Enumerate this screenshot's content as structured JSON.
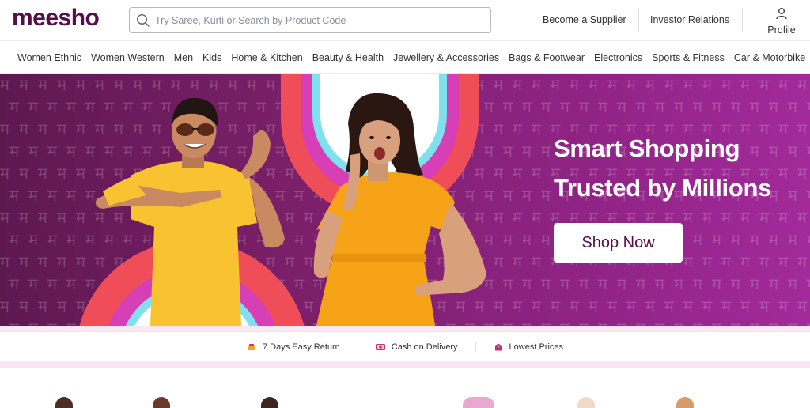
{
  "header": {
    "logo": "meesho",
    "search": {
      "placeholder": "Try Saree, Kurti or Search by Product Code",
      "value": ""
    },
    "links": [
      "Become a Supplier",
      "Investor Relations"
    ],
    "profile_label": "Profile"
  },
  "categories": [
    "Women Ethnic",
    "Women Western",
    "Men",
    "Kids",
    "Home & Kitchen",
    "Beauty & Health",
    "Jewellery & Accessories",
    "Bags & Footwear",
    "Electronics",
    "Sports & Fitness",
    "Car & Motorbike"
  ],
  "hero": {
    "headline_line1": "Smart Shopping",
    "headline_line2": "Trusted by Millions",
    "cta": "Shop Now",
    "pattern_glyph": "म"
  },
  "value_props": [
    {
      "label": "7 Days Easy Return",
      "icon": "return-icon"
    },
    {
      "label": "Cash on Delivery",
      "icon": "cash-icon"
    },
    {
      "label": "Lowest Prices",
      "icon": "price-tag-icon"
    }
  ],
  "colors": {
    "brand": "#570d48",
    "hero_purple": "#8e2383",
    "arch_red": "#ef4e58",
    "arch_magenta": "#d63fb5",
    "arch_cyan": "#7fe1ef",
    "shirt_yellow": "#f9c230",
    "dress_orange": "#f6a317"
  }
}
